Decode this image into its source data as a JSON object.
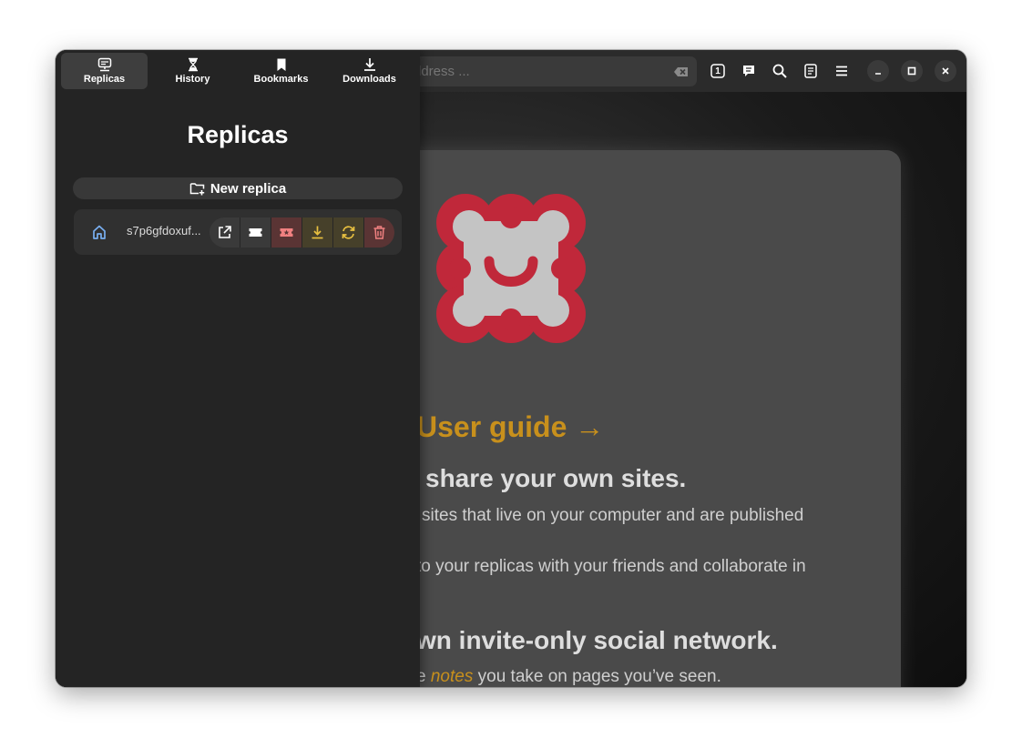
{
  "sidebar": {
    "tabs": [
      {
        "label": "Replicas",
        "icon": "replicas-icon",
        "active": true
      },
      {
        "label": "History",
        "icon": "hourglass-icon",
        "active": false
      },
      {
        "label": "Bookmarks",
        "icon": "bookmark-icon",
        "active": false
      },
      {
        "label": "Downloads",
        "icon": "download-icon",
        "active": false
      }
    ],
    "title": "Replicas",
    "new_replica_label": "New replica",
    "replicas": [
      {
        "name": "s7p6gfdoxuf...",
        "icon": "home-icon"
      }
    ]
  },
  "toolbar": {
    "url_placeholder": "ddress ...",
    "tab_count": "1"
  },
  "page": {
    "user_guide_link": "User guide →",
    "heading_share": "share your own sites.",
    "para_sites": "sites that live on your computer and are published",
    "para_replicas": "to your replicas with your friends and collaborate in",
    "heading_social": "wn invite-only social network.",
    "para_notes_prefix": "e ",
    "para_notes_link": "notes",
    "para_notes_suffix": " you take on pages you’ve seen."
  },
  "colors": {
    "accent_orange": "#c8901c",
    "logo_red": "#c0283a",
    "home_blue": "#78aef0",
    "action_yellow": "#e8c040",
    "action_red": "#f08080"
  }
}
